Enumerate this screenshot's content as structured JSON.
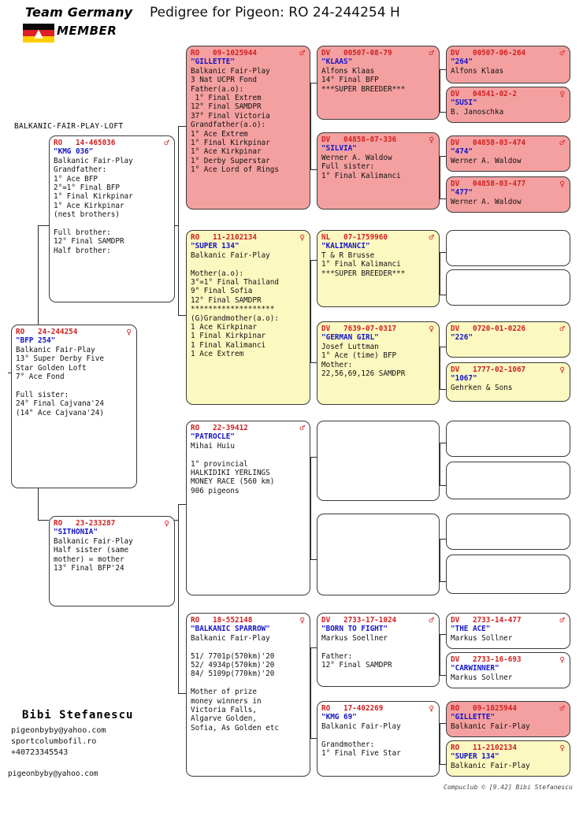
{
  "header": {
    "logo_title": "Team Germany",
    "logo_member": "MEMBER",
    "logo_flag_name": "german-flag",
    "page_title": "Pedigree for Pigeon: RO  24-244254 H"
  },
  "loft_label": "BALKANIC-FAIR-PLAY-LOFT",
  "symbols": {
    "male": "♂",
    "female": "♀"
  },
  "subject": {
    "ring": "RO   24-244254",
    "sex": "♀",
    "name": "\"BFP 254\"",
    "owner": "Balkanic Fair-Play",
    "body": "13° Super Derby Five\nStar Golden Loft\n7° Ace Fond\n\nFull sister:\n24° Final Cajvana'24\n(14° Ace Cajvana'24)"
  },
  "gen1": [
    {
      "ring": "RO   14-465036",
      "sex": "♂",
      "name": "\"KMG 036\"",
      "owner": "Balkanic Fair-Play",
      "body": "Grandfather:\n1° Ace BFP\n2°=1° Final BFP\n1° Final Kirkpinar\n1° Ace Kirkpinar\n(nest brothers)\n\nFull brother:\n12° Final SAMDPR\nHalf brother:",
      "color": "white"
    },
    {
      "ring": "RO   23-233287",
      "sex": "♀",
      "name": "\"SITHONIA\"",
      "owner": "Balkanic Fair-Play",
      "body": "Half sister (same\nmother) = mother\n13° Final BFP'24",
      "color": "white"
    }
  ],
  "gen2": [
    {
      "ring": "RO   09-1025944",
      "sex": "♂",
      "name": "\"GILLETTE\"",
      "owner": "Balkanic Fair-Play",
      "body": "3 Nat UCPR Fond\nFather(a.o):\n 1° Final Extrem\n12° Final SAMDPR\n37° Final Victoria\nGrandfather(a.o):\n1° Ace Extrem\n1° Final Kirkpinar\n1° Ace Kirkpinar\n1° Derby Superstar\n1° Ace Lord of Rings",
      "color": "pink"
    },
    {
      "ring": "RO   11-2102134",
      "sex": "♀",
      "name": "\"SUPER 134\"",
      "owner": "Balkanic Fair-Play",
      "body": "\nMother(a.o):\n3°=1° Final Thailand\n9° Final Sofia\n12° Final SAMDPR\n*******************\n(G)Grandmother(a.o):\n1 Ace Kirkpinar\n1 Final Kirkpinar\n1 Final Kalimanci\n1 Ace Extrem",
      "color": "yellow"
    },
    {
      "ring": "RO   22-39412",
      "sex": "♂",
      "name": "\"PATROCLE\"",
      "owner": "Mihai Huiu",
      "body": "\n1° provincial\nHALKIDIKI YERLINGS\nMONEY RACE (560 km)\n906 pigeons",
      "color": "white"
    },
    {
      "ring": "RO   18-552148",
      "sex": "♀",
      "name": "\"BALKANIC SPARROW\"",
      "owner": "Balkanic Fair-Play",
      "body": "\n51/ 7701p(570km)'20\n52/ 4934p(570km)'20\n84/ 5109p(770km)'20\n\nMother of prize\nmoney winners in\nVictoria Falls,\nAlgarve Golden,\nSofia, As Golden etc",
      "color": "white"
    }
  ],
  "gen3": [
    {
      "ring": "DV   00507-08-79",
      "sex": "♂",
      "name": "\"KLAAS\"",
      "owner": "Alfons Klaas",
      "body": "14° Final BFP\n***SUPER BREEDER***",
      "color": "pink"
    },
    {
      "ring": "DV   04858-07-336",
      "sex": "♀",
      "name": "\"SILVIA\"",
      "owner": "Werner A. Waldow",
      "body": "Full sister:\n1° Final Kalimanci",
      "color": "pink"
    },
    {
      "ring": "NL   07-1759960",
      "sex": "♂",
      "name": "\"KALIMANCI\"",
      "owner": "T & R Brusse",
      "body": "1° Final Kalimanci\n***SUPER BREEDER***",
      "color": "yellow"
    },
    {
      "ring": "DV   7639-07-0317",
      "sex": "♀",
      "name": "\"GERMAN GIRL\"",
      "owner": "Josef Luttman",
      "body": "1° Ace (time) BFP\nMother:\n22,56,69,126 SAMDPR",
      "color": "yellow"
    },
    {
      "ring": "",
      "sex": "",
      "name": "",
      "owner": "",
      "body": "",
      "color": "white"
    },
    {
      "ring": "",
      "sex": "",
      "name": "",
      "owner": "",
      "body": "",
      "color": "white"
    },
    {
      "ring": "",
      "sex": "",
      "name": "",
      "owner": "",
      "body": "",
      "color": "white"
    },
    {
      "ring": "",
      "sex": "",
      "name": "",
      "owner": "",
      "body": "",
      "color": "white"
    },
    {
      "ring": "DV   2733-17-1024",
      "sex": "♂",
      "name": "\"BORN TO FIGHT\"",
      "owner": "Markus Soellner",
      "body": "\nFather:\n12° Final SAMDPR",
      "color": "white"
    },
    {
      "ring": "RO   17-402269",
      "sex": "♀",
      "name": "\"KMG 69\"",
      "owner": "Balkanic Fair-Play",
      "body": "\nGrandmother:\n1° Final Five Star",
      "color": "white"
    }
  ],
  "gen4": [
    {
      "ring": "DV   00507-06-264",
      "sex": "♂",
      "name": "\"264\"",
      "owner": "Alfons Klaas",
      "color": "pink"
    },
    {
      "ring": "DV   04541-02-2",
      "sex": "♀",
      "name": "\"SUSI\"",
      "owner": "B. Janoschka",
      "color": "pink"
    },
    {
      "ring": "DV   04858-03-474",
      "sex": "♂",
      "name": "\"474\"",
      "owner": "Werner A. Waldow",
      "color": "pink"
    },
    {
      "ring": "DV   04858-03-477",
      "sex": "♀",
      "name": "\"477\"",
      "owner": "Werner A. Waldow",
      "color": "pink"
    },
    {
      "ring": "",
      "sex": "",
      "name": "",
      "owner": "",
      "color": "white"
    },
    {
      "ring": "",
      "sex": "",
      "name": "",
      "owner": "",
      "color": "white"
    },
    {
      "ring": "DV   0720-01-0226",
      "sex": "♂",
      "name": "\"226\"",
      "owner": "",
      "color": "yellow"
    },
    {
      "ring": "DV   1777-02-1067",
      "sex": "♀",
      "name": "\"1067\"",
      "owner": "Gehrken & Sons",
      "color": "yellow"
    },
    {
      "ring": "",
      "sex": "",
      "name": "",
      "owner": "",
      "color": "white"
    },
    {
      "ring": "",
      "sex": "",
      "name": "",
      "owner": "",
      "color": "white"
    },
    {
      "ring": "",
      "sex": "",
      "name": "",
      "owner": "",
      "color": "white"
    },
    {
      "ring": "",
      "sex": "",
      "name": "",
      "owner": "",
      "color": "white"
    },
    {
      "ring": "DV   2733-14-477",
      "sex": "♂",
      "name": "\"THE ACE\"",
      "owner": "Markus Sollner",
      "color": "white"
    },
    {
      "ring": "DV   2733-16-693",
      "sex": "♀",
      "name": "\"CARWINNER\"",
      "owner": "Markus Sollner",
      "color": "white"
    },
    {
      "ring": "RO   09-1025944",
      "sex": "♂",
      "name": "\"GILLETTE\"",
      "owner": "Balkanic Fair-Play",
      "color": "pink"
    },
    {
      "ring": "RO   11-2102134",
      "sex": "♀",
      "name": "\"SUPER 134\"",
      "owner": "Balkanic Fair-Play",
      "color": "yellow"
    }
  ],
  "footer": {
    "owner_name": "Bibi Stefanescu",
    "contact": "pigeonbyby@yahoo.com\nsportcolumbofil.ro\n+40723345543",
    "email2": "pigeonbyby@yahoo.com",
    "credit": "Compuclub © [9.42]  Bibi Stefanescu"
  },
  "colors": {
    "ring_red": "#d22020",
    "name_blue": "#1414c8",
    "pink_box": "#f4a0a0",
    "yellow_box": "#fbf8c0",
    "border": "#3a3a3a"
  }
}
